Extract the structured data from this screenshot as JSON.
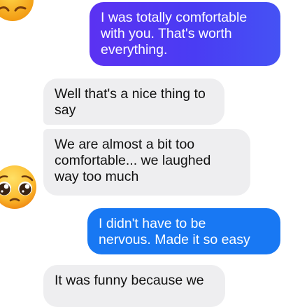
{
  "messages": [
    {
      "id": "b1",
      "sender": "me",
      "text": "I was totally comfortable\nwith you.  That's worth\neverything."
    },
    {
      "id": "b2",
      "sender": "them",
      "text": "Well that's a nice thing to\nsay"
    },
    {
      "id": "b3",
      "sender": "them",
      "text": "We are almost a bit too\ncomfortable... we laughed\nway too much"
    },
    {
      "id": "b4",
      "sender": "me",
      "text": "I didn't have to be\nnervous. Made it so easy"
    },
    {
      "id": "b5",
      "sender": "them",
      "text": "It was funny because we"
    }
  ],
  "reactions": [
    {
      "icon": "grimace-emoji-icon"
    },
    {
      "icon": "pleading-face-emoji-icon"
    }
  ],
  "colors": {
    "sent_gradient_start": "#5b32f2",
    "sent_gradient_end": "#4552f4",
    "sent_blue": "#1878f3",
    "received_bg": "#eeeef0"
  }
}
